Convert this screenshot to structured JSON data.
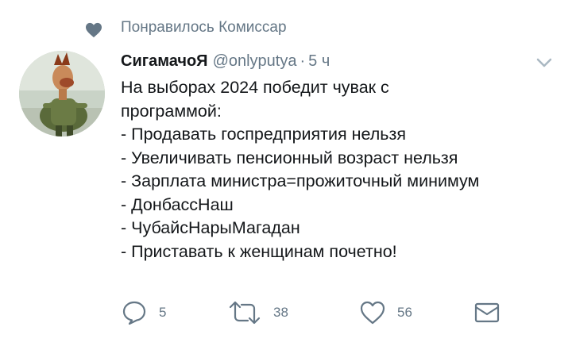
{
  "social_context": {
    "text": "Понравилось Комиссар",
    "icon": "heart-icon"
  },
  "tweet": {
    "display_name": "СигамачоЯ",
    "handle": "@onlyputya",
    "separator": "·",
    "time": "5 ч",
    "lines": [
      "На выборах 2024 победит чувак с",
      "программой:",
      "- Продавать госпредприятия нельзя",
      "- Увеличивать пенсионный возраст нельзя",
      "- Зарплата министра=прожиточный минимум",
      "- ДонбассНаш",
      "- ЧубайсНарыМагадан",
      "- Приставать к женщинам почетно!"
    ]
  },
  "actions": {
    "reply_count": "5",
    "retweet_count": "38",
    "like_count": "56"
  },
  "colors": {
    "text": "#14171a",
    "muted": "#657786",
    "background": "#ffffff"
  }
}
